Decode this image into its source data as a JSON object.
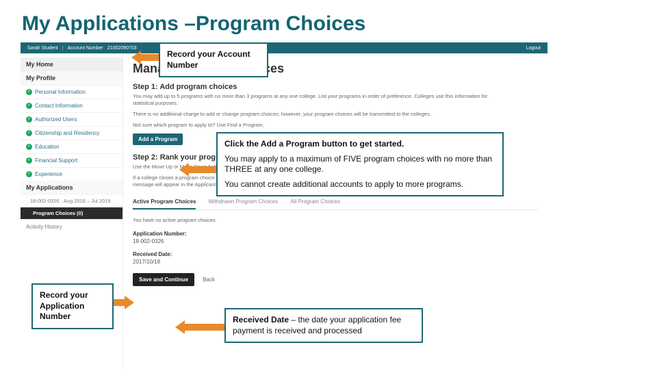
{
  "slide": {
    "title": "My Applications –Program Choices"
  },
  "topbar": {
    "user": "Sarah Student",
    "acct_label": "Account Number",
    "acct_number": "21002090703",
    "logout": "Logout"
  },
  "sidebar": {
    "home": "My Home",
    "profile": "My Profile",
    "items": [
      {
        "label": "Personal Information"
      },
      {
        "label": "Contact Information"
      },
      {
        "label": "Authorized Users"
      },
      {
        "label": "Citizenship and Residency"
      },
      {
        "label": "Education"
      },
      {
        "label": "Financial Support"
      },
      {
        "label": "Experience"
      }
    ],
    "apps_header": "My Applications",
    "cycle": "18-002-0326 · Aug 2018 – Jul 2019",
    "program_choices": "Program Choices (0)",
    "activity": "Activity History"
  },
  "main": {
    "page_title": "Manage Program Choices",
    "step1_title": "Step 1: Add program choices",
    "step1_p1": "You may add up to 5 programs with no more than 3 programs at any one college. List your programs in order of preference. Colleges use this information for statistical purposes.",
    "step1_p2": "There is no additional charge to add or change program choices; however, your program choices will be transmitted to the colleges.",
    "step1_p3": "Not sure which program to apply to? Use Find a Program.",
    "add_btn": "Add a Program",
    "step2_title": "Step 2: Rank your program choices",
    "step2_p1": "Use the Move Up or Move Down buttons to rank a program choice you've previously applied to or attended.",
    "closed_para": "If a college closes a program choice you've added before you've paid your application fee, the program will be removed from your application automatically. A message will appear in the Applicant Dashboard screen notifying you that the program was removed.",
    "tabs": {
      "active": "Active Program Choices",
      "withdrawn": "Withdrawn Program Choices",
      "all": "All Program Choices"
    },
    "no_active": "You have no active program choices.",
    "app_num_label": "Application Number:",
    "app_num_value": "18-002-0326",
    "recv_label": "Received Date:",
    "recv_value": "2017/10/18",
    "save_btn": "Save and Continue",
    "back": "Back"
  },
  "callouts": {
    "c1": "Record your Account Number",
    "c2a": "Click the Add a Program button to get started.",
    "c2b": "You may apply to a maximum of FIVE program choices with no more than THREE at any one college.",
    "c2c": "You cannot create additional accounts to apply to more programs.",
    "c3": "Record your Application Number",
    "c4_lead": "Received Date",
    "c4_rest": " – the date your application fee payment is received and processed"
  }
}
